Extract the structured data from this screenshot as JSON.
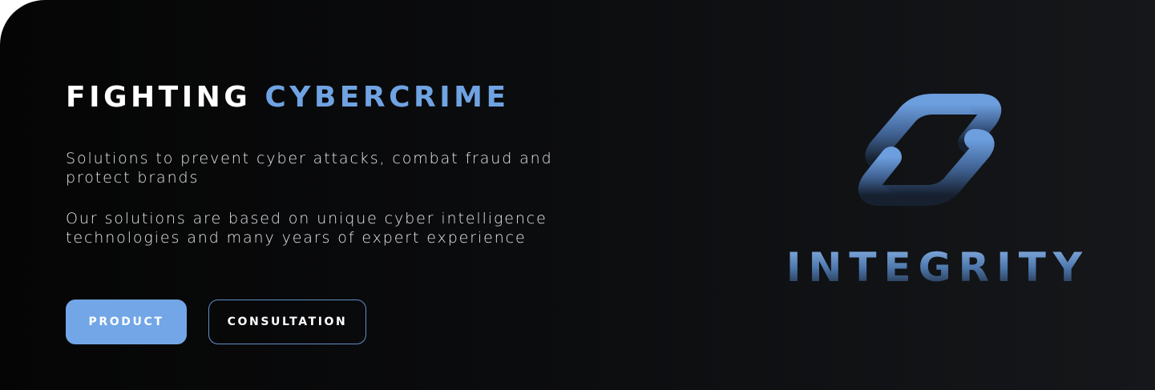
{
  "hero": {
    "headline_white": "FIGHTING",
    "headline_accent": "CYBERCRIME",
    "paragraph_1": "Solutions to prevent cyber attacks, combat fraud and protect brands",
    "paragraph_2": "Our solutions are based on unique cyber intelligence technologies and many years of expert experience"
  },
  "buttons": {
    "product_label": "PRODUCT",
    "consultation_label": "CONSULTATION"
  },
  "logo": {
    "wordmark": "INTEGRITY",
    "icon": "chain-link-icon"
  },
  "colors": {
    "accent": "#6fa3e2",
    "button_fill": "#72a6e6",
    "background": "#0b0c0e",
    "text": "#ffffff"
  }
}
